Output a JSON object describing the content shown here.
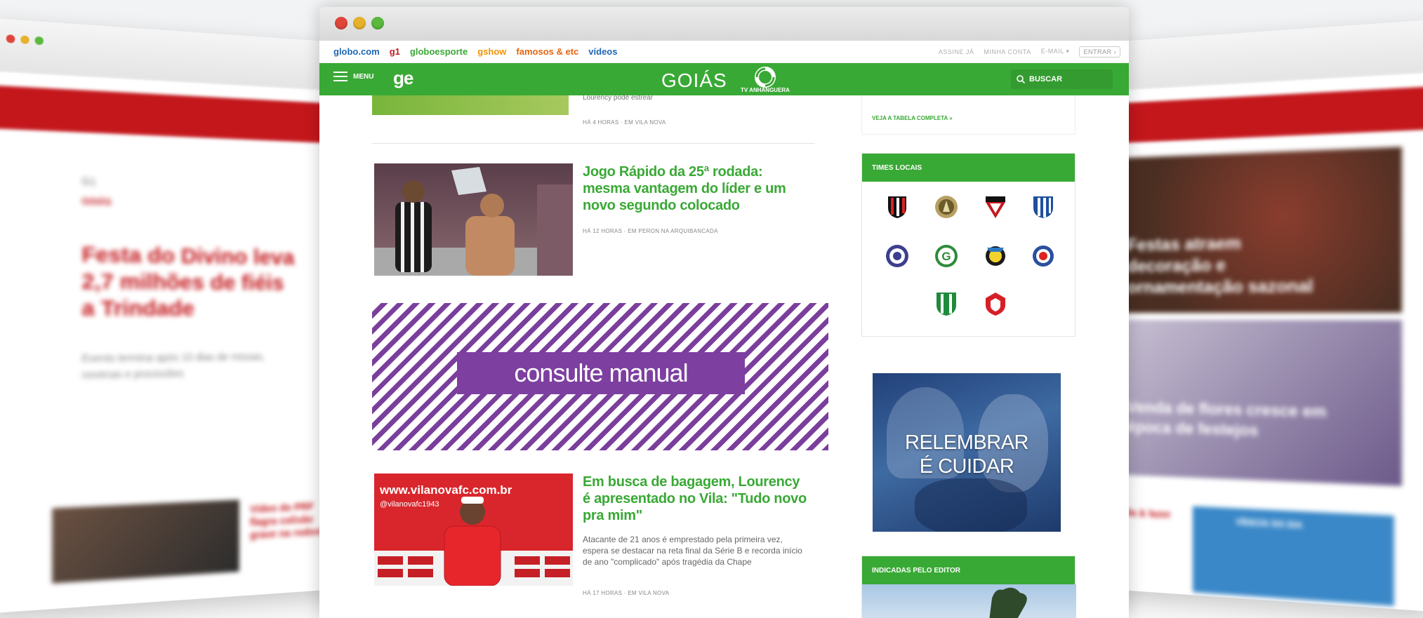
{
  "main_window": {
    "chrome_dots": [
      "#e0453a",
      "#e6b22b",
      "#5ab93e"
    ],
    "globo_links": [
      {
        "label": "globo.com",
        "color": "#1d67b3"
      },
      {
        "label": "g1",
        "color": "#c4171c"
      },
      {
        "label": "globoesporte",
        "color": "#39a935"
      },
      {
        "label": "gshow",
        "color": "#f39200"
      },
      {
        "label": "famosos & etc",
        "color": "#e6640f"
      },
      {
        "label": "vídeos",
        "color": "#1d67b3"
      }
    ],
    "account_links": [
      "ASSINE JÁ",
      "MINHA CONTA",
      "E-MAIL",
      "ENTRAR"
    ],
    "header": {
      "menu_label": "MENU",
      "logo": "ge",
      "region": "GOIÁS",
      "tv_name": "TV ANHANGUERA",
      "search_label": "BUSCAR",
      "brand_color": "#39a935"
    },
    "feed": {
      "previous": {
        "snippet": "Lourency pode estrear",
        "meta": "HÁ 4 HORAS · EM VILA NOVA"
      },
      "posts": [
        {
          "title": "Jogo Rápido da 25ª rodada: mesma vantagem do líder e um novo segundo colocado",
          "meta": "HÁ 12 HORAS · EM PERON NA ARQUIBANCADA"
        },
        {
          "title": "Em busca de bagagem, Lourency é apresentado no Vila: \"Tudo novo pra mim\"",
          "summary": "Atacante de 21 anos é emprestado pela primeira vez, espera se destacar na reta final da Série B e recorda início de ano \"complicado\" após tragédia da Chape",
          "meta": "HÁ 17 HORAS · EM VILA NOVA",
          "banner_text": "www.vilanovafc.com.br",
          "banner_handles": [
            "vilanovafc1943",
            "@vilanovafc1943",
            "@vilan"
          ]
        }
      ],
      "ad_label": "consulte manual"
    },
    "sidebar": {
      "table_link": "VEJA A TABELA COMPLETA »",
      "local_teams_title": "TIMES LOCAIS",
      "promo_text": [
        "RELEMBRAR",
        "É CUIDAR"
      ],
      "editor_title": "INDICADAS PELO EDITOR"
    }
  },
  "background_windows": {
    "left": {
      "tag": "G1",
      "section": "GOIÁS",
      "headline": "Festa do Divino leva 2,7 milhões de fiéis a Trindade",
      "subtitle": "Evento termina após 10 dias de missas, novenas e procissões",
      "side_title": "Vídeo do PRF flagra colisão grave na rodovia"
    },
    "right": {
      "card1": "Festas atraem decoração e ornamentação sazonal",
      "card2": "Venda de flores cresce em época de festejos",
      "side_text": "Vida & lazer",
      "button": "VÍDEOS DO DIA"
    }
  }
}
